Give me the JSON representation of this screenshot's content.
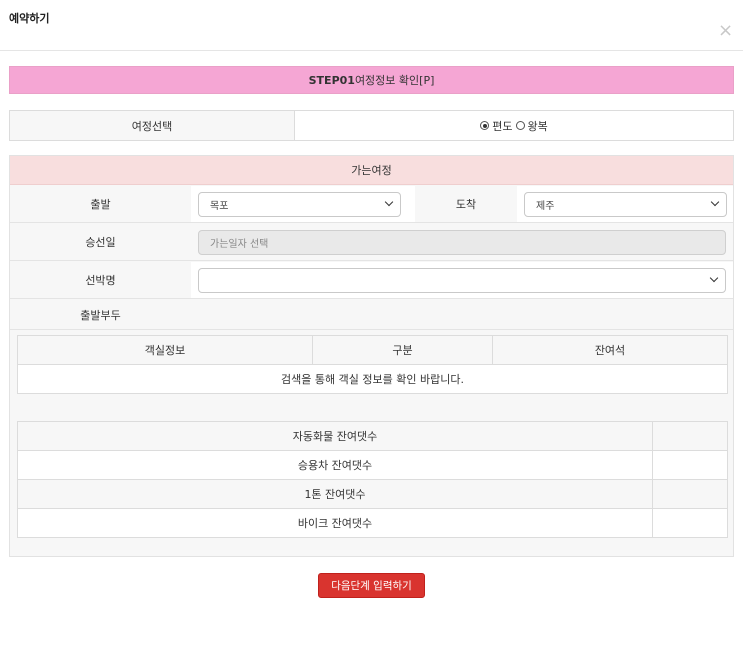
{
  "modal": {
    "title": "예약하기",
    "close": "×"
  },
  "step": {
    "bold": "STEP01",
    "text": "여정정보 확인[P]"
  },
  "trip_select": {
    "label": "여정선택",
    "options": [
      {
        "label": "편도",
        "checked": true
      },
      {
        "label": "왕복",
        "checked": false
      }
    ]
  },
  "section": {
    "title": "가는여정"
  },
  "departure": {
    "label": "출발",
    "value": "목포"
  },
  "arrival": {
    "label": "도착",
    "value": "제주"
  },
  "sail_date": {
    "label": "승선일",
    "placeholder": "가는일자 선택"
  },
  "ship_name": {
    "label": "선박명",
    "value": ""
  },
  "dock": {
    "label": "출발부두",
    "value": ""
  },
  "cabin_table": {
    "headers": [
      "객실정보",
      "구분",
      "잔여석"
    ],
    "empty_message": "검색을 통해 객실 정보를 확인 바랍니다."
  },
  "vehicle_table": {
    "rows": [
      {
        "label": "자동화물 잔여댓수",
        "value": ""
      },
      {
        "label": "승용차 잔여댓수",
        "value": ""
      },
      {
        "label": "1톤 잔여댓수",
        "value": ""
      },
      {
        "label": "바이크 잔여댓수",
        "value": ""
      }
    ]
  },
  "next_button": {
    "label": "다음단계 입력하기"
  },
  "colors": {
    "step_banner": "#f5a6d4",
    "section_header": "#f8dede",
    "next_button": "#d9342f"
  }
}
